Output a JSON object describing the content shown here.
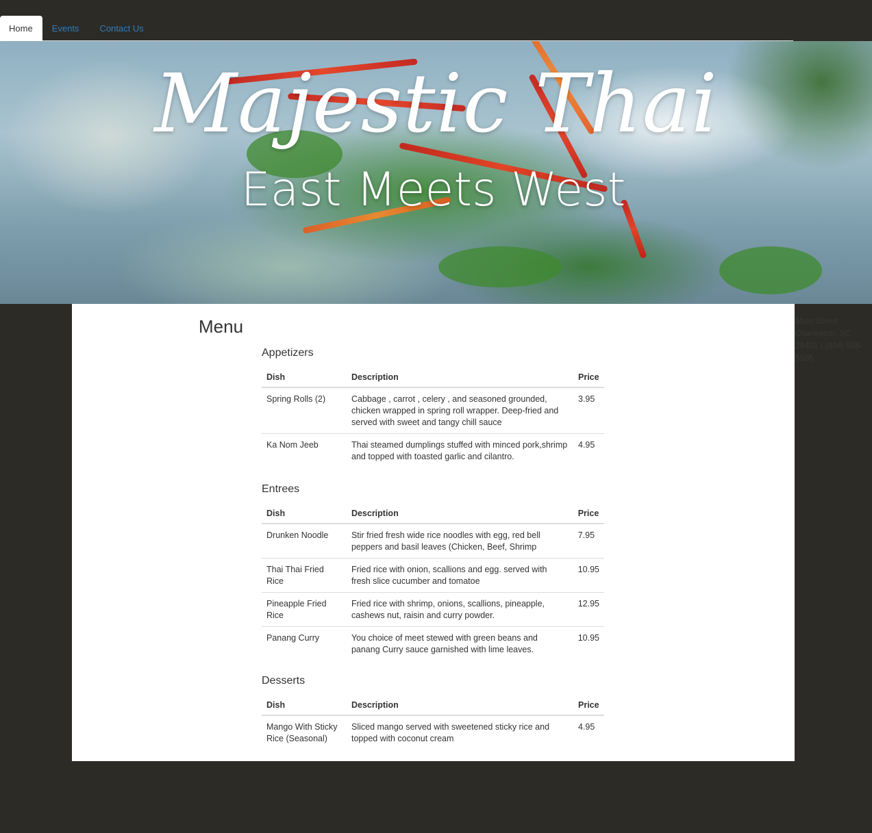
{
  "nav": {
    "tabs": [
      {
        "label": "Home",
        "active": true
      },
      {
        "label": "Events",
        "active": false
      },
      {
        "label": "Contact Us",
        "active": false
      }
    ]
  },
  "hero": {
    "title": "Majestic Thai",
    "subtitle": "East Meets West"
  },
  "address": {
    "lines": [
      "Main Street",
      "Charleston, SC",
      "29401 | (804) 555-",
      "5555"
    ]
  },
  "menu": {
    "heading": "Menu",
    "columns": {
      "dish": "Dish",
      "description": "Description",
      "price": "Price"
    },
    "sections": [
      {
        "title": "Appetizers",
        "items": [
          {
            "dish": "Spring Rolls (2)",
            "description": "Cabbage , carrot , celery , and seasoned grounded, chicken wrapped in spring roll wrapper. Deep-fried and served with sweet and tangy chill sauce",
            "price": "3.95"
          },
          {
            "dish": "Ka Nom Jeeb",
            "description": "Thai steamed dumplings stuffed with minced pork,shrimp and topped with toasted garlic and cilantro.",
            "price": "4.95"
          }
        ]
      },
      {
        "title": "Entrees",
        "items": [
          {
            "dish": "Drunken Noodle",
            "description": "Stir fried fresh wide rice noodles with egg, red bell peppers and basil leaves (Chicken, Beef, Shrimp",
            "price": "7.95"
          },
          {
            "dish": "Thai Thai Fried Rice",
            "description": "Fried rice with onion, scallions and egg. served with fresh slice cucumber and tomatoe",
            "price": "10.95"
          },
          {
            "dish": "Pineapple Fried Rice",
            "description": "Fried rice with shrimp, onions, scallions, pineapple, cashews nut, raisin and curry powder.",
            "price": "12.95"
          },
          {
            "dish": "Panang Curry",
            "description": "You choice of meet stewed with green beans and panang Curry sauce garnished with lime leaves.",
            "price": "10.95"
          }
        ]
      },
      {
        "title": "Desserts",
        "items": [
          {
            "dish": "Mango With Sticky Rice (Seasonal)",
            "description": "Sliced mango served with sweetened sticky rice and topped with coconut cream",
            "price": "4.95"
          }
        ]
      }
    ]
  }
}
